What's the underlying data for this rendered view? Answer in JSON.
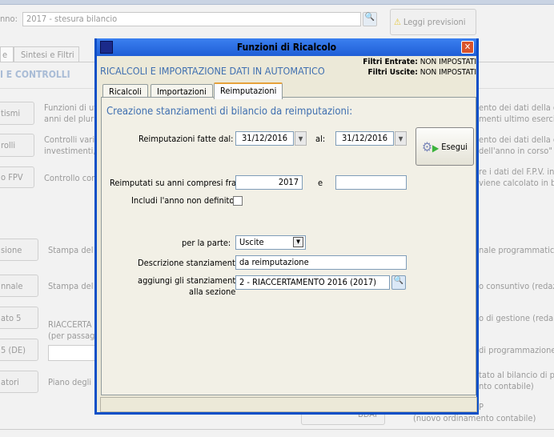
{
  "background": {
    "anno_label": "nno:",
    "anno_value": "2017 - stesura bilancio",
    "leggi_previsioni": "Leggi previsioni",
    "tabs": [
      "e",
      "Sintesi e Filtri"
    ],
    "section_title": "I E CONTROLLI",
    "buttons": [
      "tismi",
      "rolli",
      "o FPV",
      "sione",
      "nnale",
      "ato 5",
      "5 (DE)",
      "atori",
      "BDAP"
    ],
    "left_texts": [
      "Funzioni di ut",
      "anni del plurie",
      "Controlli vari",
      "investimenti,",
      "Controllo con",
      "Stampa del b",
      "Stampa del b",
      "RIACCERTA",
      "(per passagg",
      "Piano degli i"
    ],
    "right_texts": [
      "ento dei dati della c",
      "menti ultimo eserciz",
      "ento dei dati della c",
      "dell'anno in corso\"",
      "re i dati del F.P.V. in",
      "viene calcolato in ba",
      "nale programmatica",
      "o consuntivo (redaz",
      "o di gestione (reda",
      "di programmazione",
      "tato al bilancio di pr",
      "nto contabile)",
      "P",
      "(nuovo ordinamento contabile)"
    ]
  },
  "dialog": {
    "title": "Funzioni di Ricalcolo",
    "heading": "RICALCOLI E IMPORTAZIONE DATI IN AUTOMATICO",
    "filtri_entrate_label": "Filtri Entrate:",
    "filtri_entrate_value": "NON IMPOSTATI",
    "filtri_uscite_label": "Filtri Uscite:",
    "filtri_uscite_value": "NON IMPOSTATI",
    "tabs": [
      "Ricalcoli",
      "Importazioni",
      "Reimputazioni"
    ],
    "active_tab": "Reimputazioni",
    "section_title": "Creazione stanziamenti di bilancio da reimputazioni:",
    "fatte_dal_label": "Reimputazioni fatte dal:",
    "fatte_dal_value": "31/12/2016",
    "al_label": "al:",
    "al_value": "31/12/2016",
    "esegui": "Esegui",
    "anni_label": "Reimputati su anni compresi fra",
    "anni_da": "2017",
    "e_label": "e",
    "anni_a": "",
    "includi_label": "Includi l'anno non definito",
    "includi_checked": false,
    "parte_label": "per la parte:",
    "parte_value": "Uscite",
    "descrizione_label": "Descrizione stanziamenti",
    "descrizione_value": "da reimputazione",
    "sezione_label_1": "aggiungi gli stanziamenti",
    "sezione_label_2": "alla sezione",
    "sezione_value": "2 - RIACCERTAMENTO 2016 (2017)"
  },
  "colors": {
    "accent_text": "#3f6fb0",
    "title_bar": "#1f5ed6",
    "close": "#d9532b"
  }
}
